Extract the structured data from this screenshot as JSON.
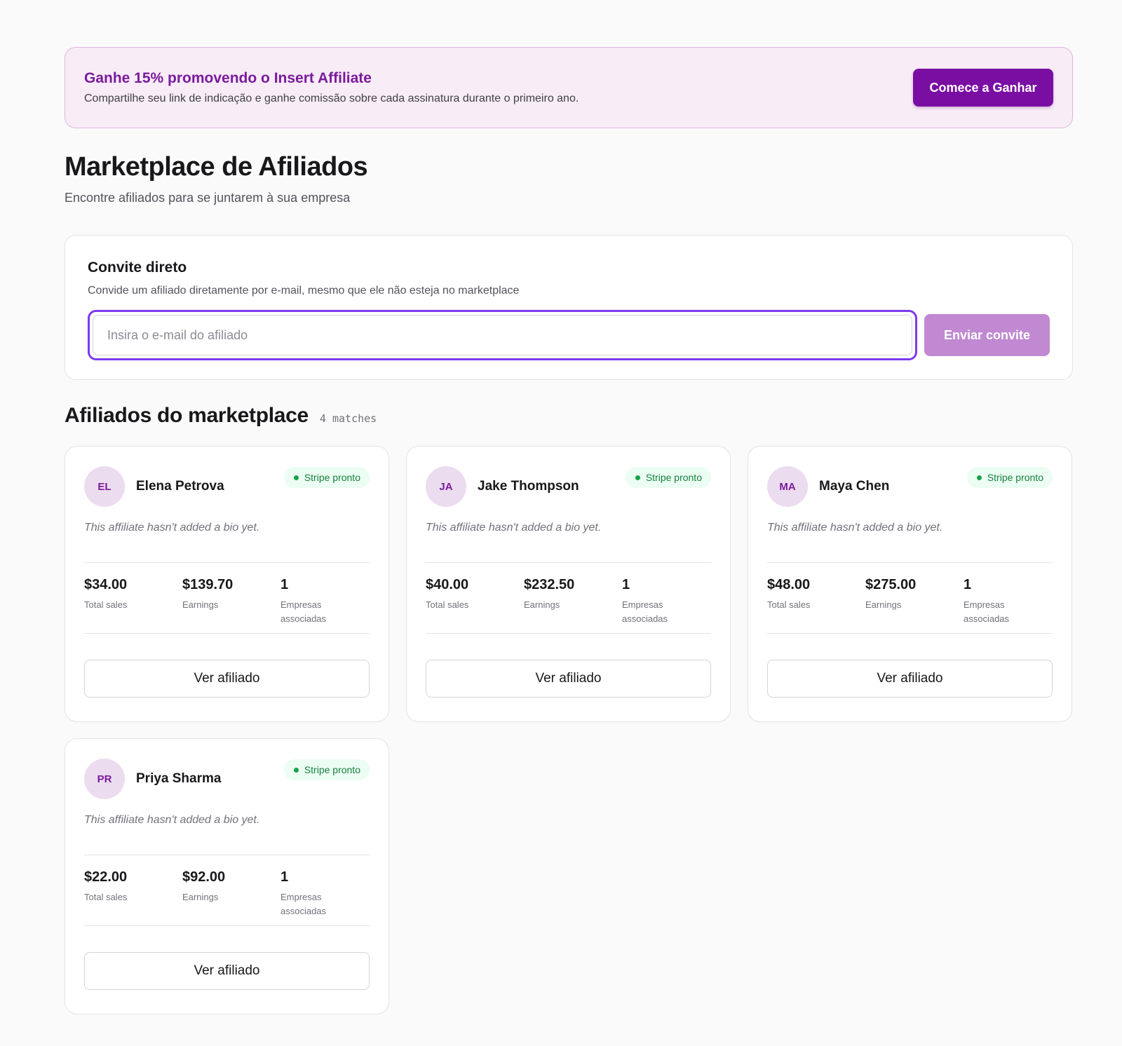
{
  "promo": {
    "title": "Ganhe 15% promovendo o Insert Affiliate",
    "text": "Compartilhe seu link de indicação e ganhe comissão sobre cada assinatura durante o primeiro ano.",
    "button": "Comece a Ganhar"
  },
  "page": {
    "title": "Marketplace de Afiliados",
    "subtitle": "Encontre afiliados para se juntarem à sua empresa"
  },
  "invite": {
    "title": "Convite direto",
    "description": "Convide um afiliado diretamente por e-mail, mesmo que ele não esteja no marketplace",
    "placeholder": "Insira o e-mail do afiliado",
    "button": "Enviar convite"
  },
  "marketplace": {
    "title": "Afiliados do marketplace",
    "matches": "4 matches",
    "affiliates": [
      {
        "initials": "EL",
        "name": "Elena Petrova",
        "badge": "Stripe pronto",
        "bio": "This affiliate hasn't added a bio yet.",
        "total_sales": "$34.00",
        "total_sales_label": "Total sales",
        "earnings": "$139.70",
        "earnings_label": "Earnings",
        "companies": "1",
        "companies_label": "Empresas associadas",
        "button": "Ver afiliado"
      },
      {
        "initials": "JA",
        "name": "Jake Thompson",
        "badge": "Stripe pronto",
        "bio": "This affiliate hasn't added a bio yet.",
        "total_sales": "$40.00",
        "total_sales_label": "Total sales",
        "earnings": "$232.50",
        "earnings_label": "Earnings",
        "companies": "1",
        "companies_label": "Empresas associadas",
        "button": "Ver afiliado"
      },
      {
        "initials": "MA",
        "name": "Maya Chen",
        "badge": "Stripe pronto",
        "bio": "This affiliate hasn't added a bio yet.",
        "total_sales": "$48.00",
        "total_sales_label": "Total sales",
        "earnings": "$275.00",
        "earnings_label": "Earnings",
        "companies": "1",
        "companies_label": "Empresas associadas",
        "button": "Ver afiliado"
      },
      {
        "initials": "PR",
        "name": "Priya Sharma",
        "badge": "Stripe pronto",
        "bio": "This affiliate hasn't added a bio yet.",
        "total_sales": "$22.00",
        "total_sales_label": "Total sales",
        "earnings": "$92.00",
        "earnings_label": "Earnings",
        "companies": "1",
        "companies_label": "Empresas associadas",
        "button": "Ver afiliado"
      }
    ]
  },
  "colors": {
    "brand": "#7a0ea3",
    "focus_ring": "#7c3aed",
    "success": "#16a34a"
  }
}
